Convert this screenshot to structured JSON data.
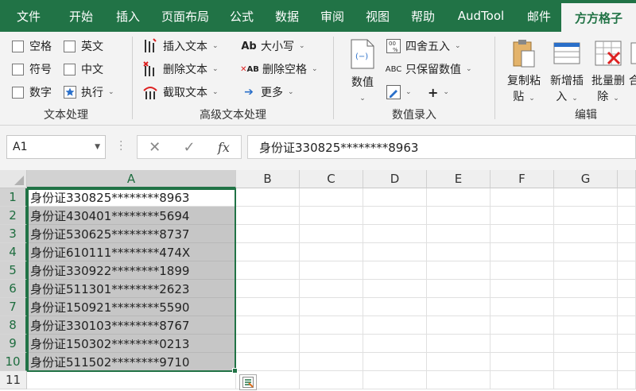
{
  "tabs": [
    "文件",
    "开始",
    "插入",
    "页面布局",
    "公式",
    "数据",
    "审阅",
    "视图",
    "帮助",
    "AudTool",
    "邮件",
    "方方格子"
  ],
  "active_tab": "方方格子",
  "colors": {
    "accent": "#217346",
    "selection": "#c6c6c6"
  },
  "ribbon": {
    "text_group": {
      "label": "文本处理",
      "checkboxes": [
        "空格",
        "英文",
        "符号",
        "中文",
        "数字"
      ],
      "execute": "执行"
    },
    "adv_group": {
      "label": "高级文本处理",
      "insert": "插入文本",
      "delete": "删除文本",
      "cut": "截取文本",
      "case": "大小写",
      "delspace": "删除空格",
      "more": "更多"
    },
    "num_group": {
      "label": "数值录入",
      "value": "数值",
      "round": "四舍五入",
      "keep": "只保留数值",
      "plus": "+"
    },
    "edit_group": {
      "label": "编辑",
      "copy_a": "复制粘",
      "copy_b": "贴",
      "newins_a": "新增插",
      "newins_b": "入",
      "batchdel_a": "批量删",
      "batchdel_b": "除",
      "more_a": "合"
    }
  },
  "formula_bar": {
    "name_box": "A1",
    "cancel": "✕",
    "enter": "✓",
    "fx": "fx",
    "content": "身份证330825********8963"
  },
  "columns": [
    "A",
    "B",
    "C",
    "D",
    "E",
    "F",
    "G"
  ],
  "rows": [
    "1",
    "2",
    "3",
    "4",
    "5",
    "6",
    "7",
    "8",
    "9",
    "10",
    "11"
  ],
  "cells_a": [
    "身份证330825********8963",
    "身份证430401********5694",
    "身份证530625********8737",
    "身份证610111********474X",
    "身份证330922********1899",
    "身份证511301********2623",
    "身份证150921********5590",
    "身份证330103********8767",
    "身份证150302********0213",
    "身份证511502********9710",
    ""
  ]
}
